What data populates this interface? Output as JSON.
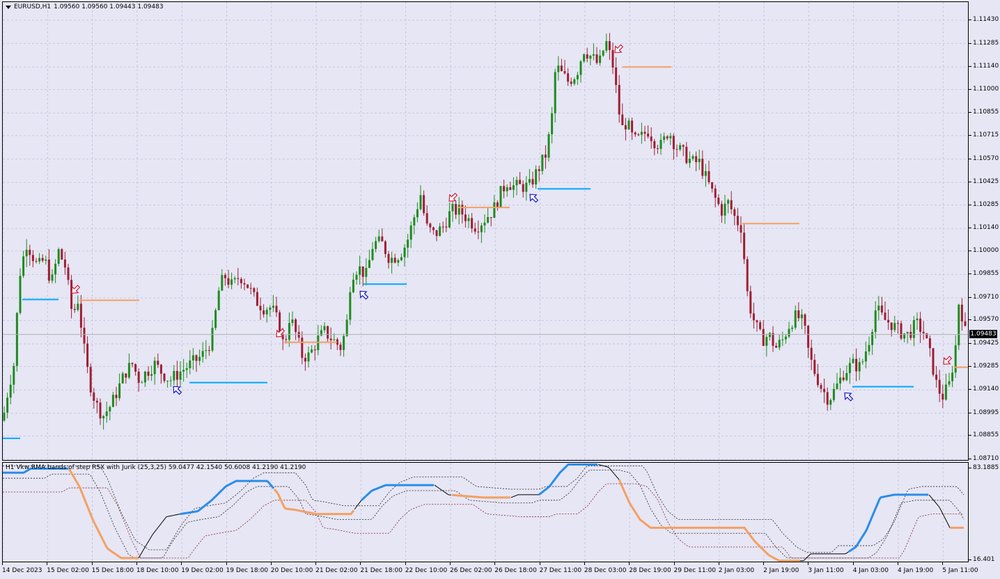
{
  "chart": {
    "symbol_label": "EURUSD,H1",
    "ohlc_text": "1.09560 1.09560 1.09443 1.09483",
    "current_price": "1.09483",
    "price_ticks": [
      "1.11430",
      "1.11285",
      "1.11140",
      "1.11000",
      "1.10855",
      "1.10715",
      "1.10570",
      "1.10425",
      "1.10285",
      "1.10140",
      "1.10000",
      "1.09855",
      "1.09710",
      "1.09570",
      "1.09425",
      "1.09285",
      "1.09140",
      "1.08995",
      "1.08855",
      "1.08710"
    ],
    "time_labels": [
      "14 Dec 2023",
      "15 Dec 02:00",
      "15 Dec 18:00",
      "18 Dec 10:00",
      "19 Dec 02:00",
      "19 Dec 18:00",
      "20 Dec 10:00",
      "21 Dec 02:00",
      "21 Dec 18:00",
      "22 Dec 10:00",
      "26 Dec 02:00",
      "26 Dec 18:00",
      "27 Dec 11:00",
      "28 Dec 03:00",
      "28 Dec 19:00",
      "29 Dec 11:00",
      "2 Jan 03:00",
      "2 Jan 19:00",
      "3 Jan 11:00",
      "4 Jan 03:00",
      "4 Jan 19:00",
      "5 Jan 11:00"
    ],
    "colors": {
      "background": "#e6e6f5",
      "bull": "#1e8c1e",
      "bear": "#a01e32",
      "up_level": "#00a8ff",
      "down_level": "#f4a060",
      "up_arrow": "#1414c8",
      "down_arrow": "#d01e3c",
      "grid": "#c8c8dc"
    }
  },
  "indicator": {
    "title": "H1 Vkw RMA bands of step RSX with Jurik (25,3,25) 59.0477 42.1540 50.6008 41.2190 41.2190",
    "top_value": "83.1885",
    "bottom_value": "16.401",
    "colors": {
      "up": "#2a8de8",
      "down": "#f4a060",
      "neutral": "#000000",
      "band_top": "#202020",
      "band_bottom": "#8a1e28"
    }
  }
}
